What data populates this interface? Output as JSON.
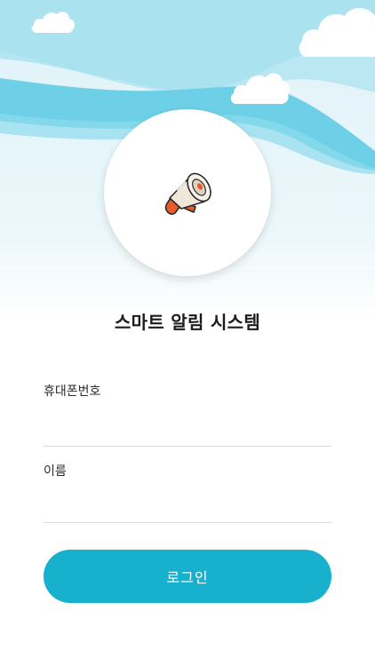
{
  "app": {
    "title": "스마트 알림 시스템"
  },
  "form": {
    "phone_label": "휴대폰번호",
    "phone_value": "",
    "name_label": "이름",
    "name_value": "",
    "login_label": "로그인"
  },
  "icons": {
    "logo": "megaphone-icon",
    "decor": [
      "cloud-icon",
      "cloud-icon",
      "cloud-icon"
    ]
  },
  "colors": {
    "accent": "#17b0cd",
    "sky_dark": "#6fd3e8",
    "sky_light": "#a9e3f0",
    "megaphone_orange": "#ec5a2c"
  }
}
